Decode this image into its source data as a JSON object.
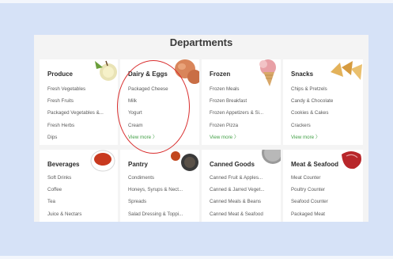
{
  "title": "Departments",
  "departments": [
    {
      "name": "Produce",
      "items": [
        "Fresh Vegetables",
        "Fresh Fruits",
        "Packaged Vegetables &...",
        "Fresh Herbs",
        "Dips"
      ],
      "icon": "apple-icon"
    },
    {
      "name": "Dairy & Eggs",
      "items": [
        "Packaged Cheese",
        "Milk",
        "Yogurt",
        "Cream"
      ],
      "view_more": "View more 〉",
      "icon": "eggs-icon"
    },
    {
      "name": "Frozen",
      "items": [
        "Frozen Meals",
        "Frozen Breakfast",
        "Frozen Appetizers & Si...",
        "Frozen Pizza"
      ],
      "view_more": "View more 〉",
      "icon": "ice-cream-icon"
    },
    {
      "name": "Snacks",
      "items": [
        "Chips & Pretzels",
        "Candy & Chocolate",
        "Cookies & Cakes",
        "Crackers"
      ],
      "view_more": "View more 〉",
      "icon": "chips-icon"
    },
    {
      "name": "Beverages",
      "items": [
        "Soft Drinks",
        "Coffee",
        "Tea",
        "Juice & Nectars"
      ],
      "icon": "tea-cup-icon"
    },
    {
      "name": "Pantry",
      "items": [
        "Condiments",
        "Honeys, Syrups & Nect...",
        "Spreads",
        "Salad Dressing & Toppi..."
      ],
      "icon": "spice-jar-icon"
    },
    {
      "name": "Canned Goods",
      "items": [
        "Canned Fruit & Apples...",
        "Canned & Jarred Veget...",
        "Canned Meals & Beans",
        "Canned Meat & Seafood"
      ],
      "icon": "can-icon"
    },
    {
      "name": "Meat & Seafood",
      "items": [
        "Meat Counter",
        "Poultry Counter",
        "Seafood Counter",
        "Packaged Meat"
      ],
      "icon": "steak-icon"
    }
  ],
  "colors": {
    "background": "#d6e2f7",
    "view_more": "#43a047",
    "annotation": "#d92e2e"
  }
}
